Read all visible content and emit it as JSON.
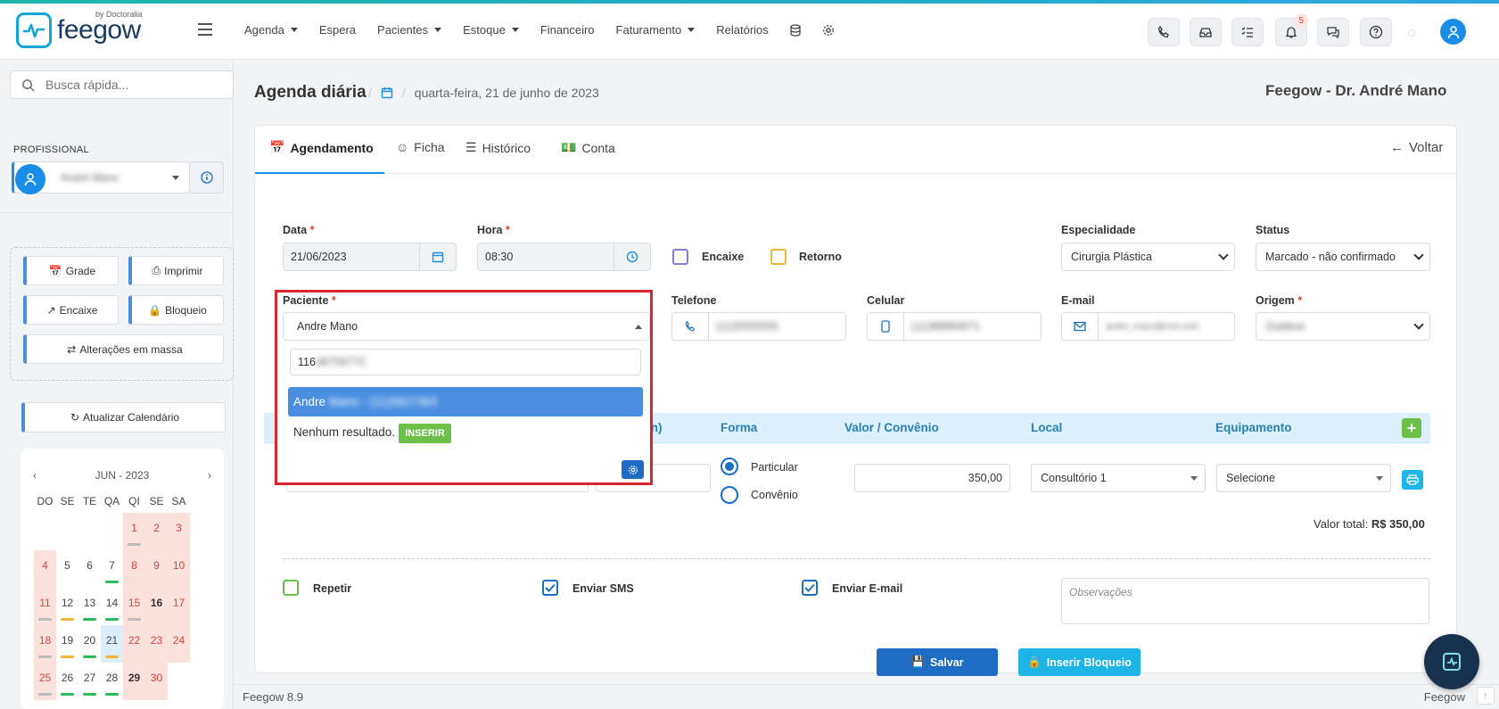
{
  "brand": {
    "name": "feegow",
    "sub": "by Doctoralia"
  },
  "nav": [
    "Agenda",
    "Espera",
    "Pacientes",
    "Estoque",
    "Financeiro",
    "Faturamento",
    "Relatórios"
  ],
  "notifications": {
    "count": "5"
  },
  "search": {
    "placeholder": "Busca rápida..."
  },
  "sidebar": {
    "profissional_label": "PROFISSIONAL",
    "profissional_value": "André Mano",
    "buttons": {
      "grade": "Grade",
      "imprimir": "Imprimir",
      "encaixe": "Encaixe",
      "bloqueio": "Bloqueio",
      "alteracoes": "Alterações em massa",
      "atualizar": "Atualizar Calendário"
    }
  },
  "calendar": {
    "month": "JUN - 2023",
    "weekdays": [
      "DO",
      "SE",
      "TE",
      "QA",
      "QI",
      "SE",
      "SA"
    ],
    "days": [
      "",
      "",
      "",
      "",
      "1",
      "2",
      "3",
      "4",
      "5",
      "6",
      "7",
      "8",
      "9",
      "10",
      "11",
      "12",
      "13",
      "14",
      "15",
      "16",
      "17",
      "18",
      "19",
      "20",
      "21",
      "22",
      "23",
      "24",
      "25",
      "26",
      "27",
      "28",
      "29",
      "30",
      ""
    ]
  },
  "page": {
    "title": "Agenda diária",
    "date": "quarta-feira, 21 de junho de 2023",
    "doctor": "Feegow - Dr. André Mano"
  },
  "tabs": [
    "Agendamento",
    "Ficha",
    "Histórico",
    "Conta"
  ],
  "back_label": "Voltar",
  "form": {
    "data_label": "Data",
    "data_value": "21/06/2023",
    "hora_label": "Hora",
    "hora_value": "08:30",
    "encaixe": "Encaixe",
    "retorno": "Retorno",
    "especialidade_label": "Especialidade",
    "especialidade_value": "Cirurgia Plástica",
    "status_label": "Status",
    "status_value": "Marcado - não confirmado",
    "paciente_label": "Paciente",
    "paciente_value": "Andre Mano",
    "telefone_label": "Telefone",
    "telefone_value": "(11)5555555",
    "celular_label": "Celular",
    "celular_value": "(11)98884971",
    "email_label": "E-mail",
    "email_value": "andre_mano@mor.com",
    "origem_label": "Origem",
    "origem_value": "Outdoor"
  },
  "dropdown": {
    "search_value": "116",
    "search_blur": "0875977C",
    "result_name": "Andre",
    "result_blur": "Mano - (11)5827383",
    "no_result": "Nenhum resultado.",
    "insert": "INSERIR"
  },
  "procedures": {
    "headers": [
      "in)",
      "Forma",
      "Valor / Convênio",
      "Local",
      "Equipamento"
    ],
    "particular": "Particular",
    "convenio": "Convênio",
    "valor": "350,00",
    "local": "Consultório 1",
    "equipamento": "Selecione",
    "total_label": "Valor total:",
    "total_value": "R$ 350,00"
  },
  "options": {
    "repetir": "Repetir",
    "sms": "Enviar SMS",
    "email": "Enviar E-mail",
    "obs_placeholder": "Observações"
  },
  "actions": {
    "salvar": "Salvar",
    "bloqueio": "Inserir Bloqueio"
  },
  "footer": {
    "version": "Feegow 8.9",
    "brand": "Feegow"
  },
  "colors": {
    "accent": "#1a8ee6",
    "weekend": "#fbe1dc",
    "danger": "#d9262c",
    "success": "#6cc04a",
    "info": "#1eb4e6"
  }
}
